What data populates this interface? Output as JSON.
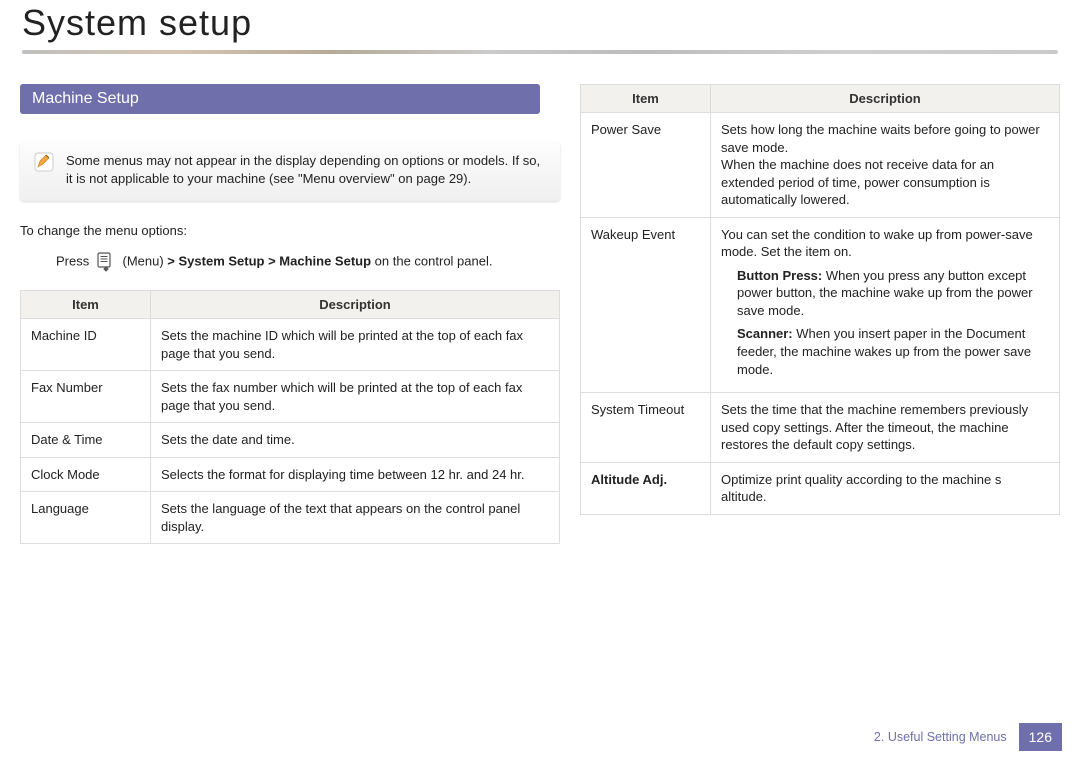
{
  "title": "System setup",
  "section_heading": "Machine Setup",
  "note_text": "Some menus may not appear in the display depending on options or models. If so, it is not applicable to your machine (see \"Menu overview\" on page 29).",
  "lead_text": "To change the menu options:",
  "press_prefix": "Press",
  "press_menu_word": "(Menu)",
  "press_path": " > System Setup > Machine Setup",
  "press_suffix": " on the control panel.",
  "headers": {
    "item": "Item",
    "description": "Description"
  },
  "left_rows": [
    {
      "item": "Machine ID",
      "desc": "Sets the machine ID which will be printed at the top of each fax page that you send."
    },
    {
      "item": "Fax Number",
      "desc": "Sets the fax number which will be printed at the top of each fax page that you send."
    },
    {
      "item": "Date & Time",
      "desc": "Sets the date and time."
    },
    {
      "item": "Clock Mode",
      "desc": "Selects the format for displaying time between 12 hr. and 24 hr."
    },
    {
      "item": "Language",
      "desc": "Sets the language of the text that appears on the control panel display."
    }
  ],
  "right_rows": {
    "power_save": {
      "item": "Power Save",
      "desc": "Sets how long the machine waits before going to power save mode.\nWhen the machine does not receive data for an extended period of time, power consumption is automatically lowered."
    },
    "wakeup": {
      "item": "Wakeup Event",
      "intro": "You can set the condition to wake up from power-save mode. Set the item on.",
      "options": [
        {
          "label": "Button Press:",
          "text": " When you press any button except power button, the machine wake up from the power save mode."
        },
        {
          "label": "Scanner:",
          "text": " When you insert paper in the Document feeder, the machine wakes up from the power save mode."
        }
      ]
    },
    "system_timeout": {
      "item": "System Timeout",
      "desc": "Sets the time that the machine remembers previously used copy settings. After the timeout, the machine restores the default copy settings."
    },
    "altitude": {
      "item": "Altitude Adj.",
      "desc": "Optimize print quality according to the machine s altitude."
    }
  },
  "footer": {
    "crumb": "2.  Useful Setting Menus",
    "page": "126"
  }
}
